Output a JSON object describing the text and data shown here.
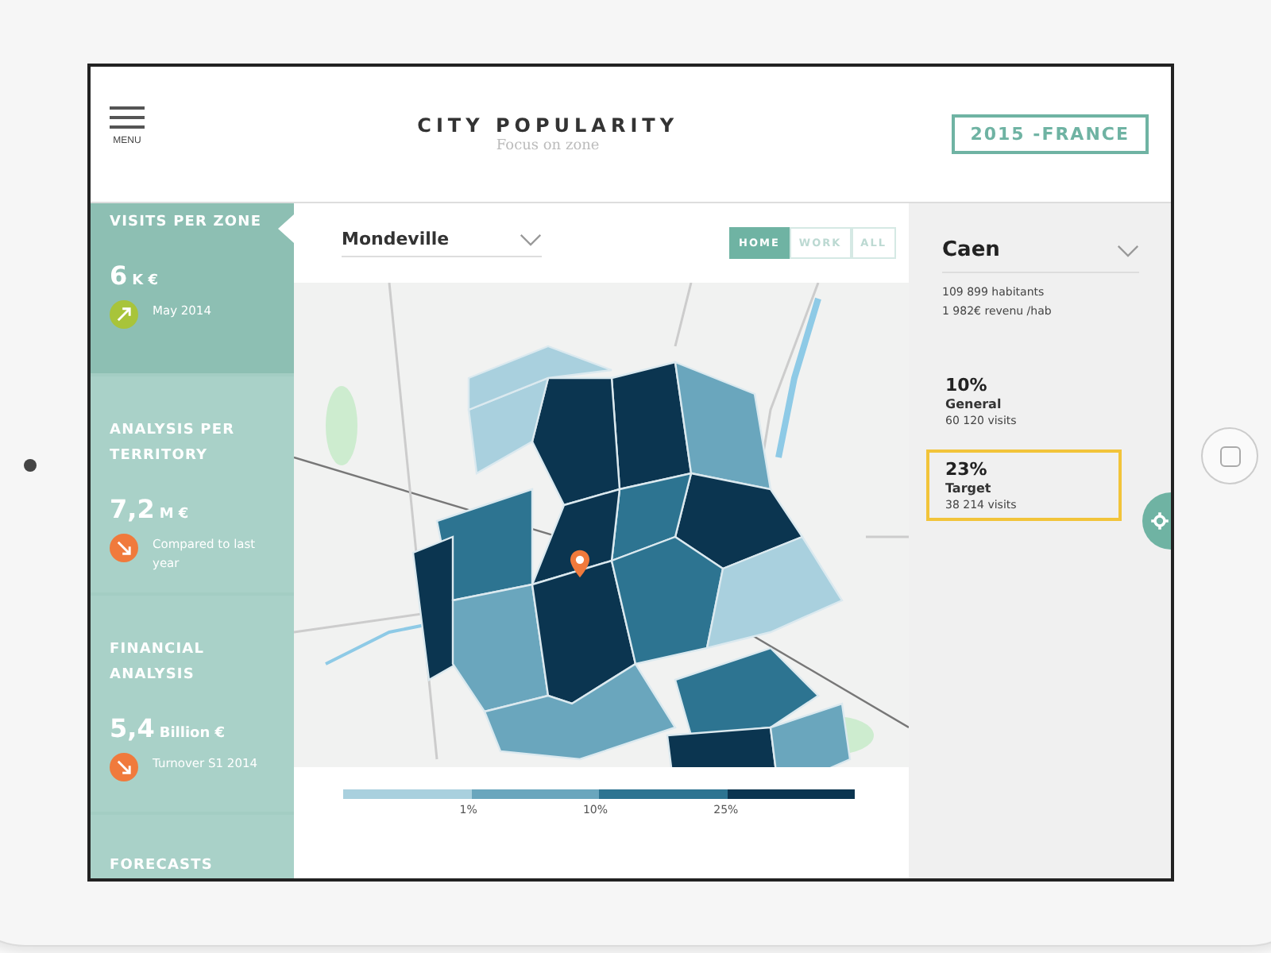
{
  "header": {
    "menu_label": "MENU",
    "title": "CITY POPULARITY",
    "subtitle": "Focus on zone",
    "badge": "2015 -FRANCE"
  },
  "sidebar": {
    "cards": [
      {
        "title": "VISITS PER ZONE",
        "value": "6",
        "unit": "K €",
        "caption": "May 2014",
        "color": "#a8c43a",
        "selected": true
      },
      {
        "title": "ANALYSIS PER TERRITORY",
        "value": "7,2",
        "unit": "M €",
        "caption": "Compared to last year",
        "color": "#f07a3c",
        "selected": false
      },
      {
        "title": "FINANCIAL ANALYSIS",
        "value": "5,4",
        "unit": "Billion €",
        "caption": "Turnover S1 2014",
        "color": "#f07a3c",
        "selected": false
      },
      {
        "title": "FORECASTS",
        "selected": false
      }
    ]
  },
  "zone_select": {
    "value": "Mondeville"
  },
  "tabs": [
    {
      "label": "HOME",
      "selected": true
    },
    {
      "label": "WORK",
      "selected": false
    },
    {
      "label": "ALL",
      "selected": false
    }
  ],
  "legend": {
    "segments": [
      {
        "color": "#a9d0de"
      },
      {
        "color": "#6aa6bd"
      },
      {
        "color": "#2d7491"
      },
      {
        "color": "#0b3550"
      }
    ],
    "ticks": [
      "1%",
      "10%",
      "25%"
    ]
  },
  "city_panel": {
    "city": "Caen",
    "facts": [
      "109 899 habitants",
      "1 982€ revenu /hab"
    ],
    "stats": [
      {
        "percent": "10%",
        "label": "General",
        "visits": "60 120 visits",
        "selected": false
      },
      {
        "percent": "23%",
        "label": "Target",
        "visits": "38 214 visits",
        "selected": true
      }
    ]
  }
}
